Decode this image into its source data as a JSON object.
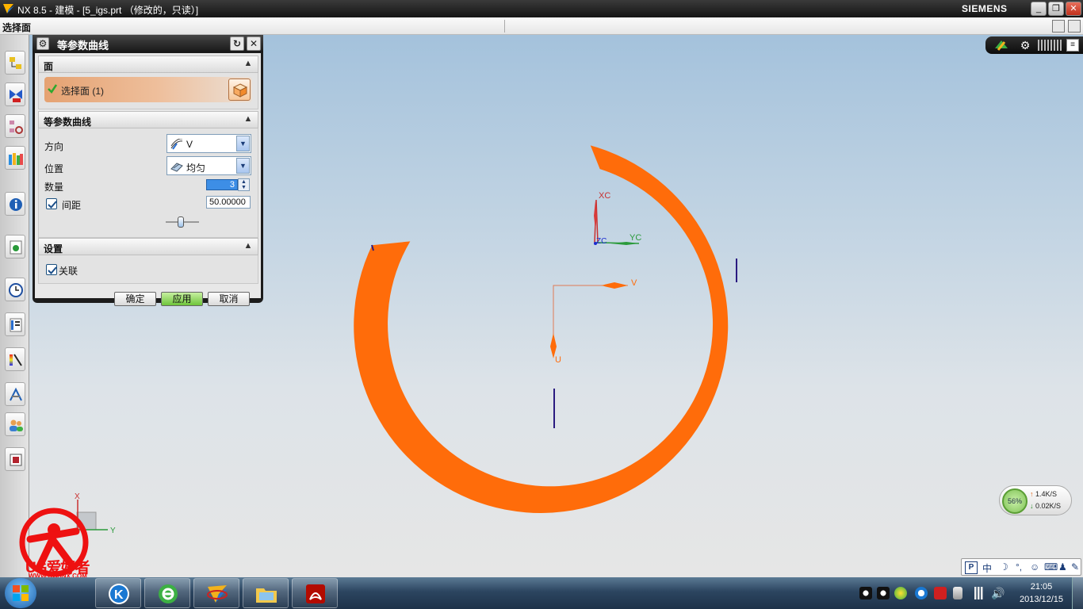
{
  "title_bar": {
    "title": "NX 8.5 - 建模 - [5_igs.prt （修改的，只读）]",
    "brand": "SIEMENS"
  },
  "cue_line": {
    "text": "选择面"
  },
  "dialog": {
    "title": "等参数曲线",
    "face_group": {
      "title": "面",
      "select_label": "选择面 (1)"
    },
    "curve_group": {
      "title": "等参数曲线",
      "direction_label": "方向",
      "direction_value": "V",
      "position_label": "位置",
      "position_value": "均匀",
      "count_label": "数量",
      "count_value": "3",
      "spacing_label": "间距",
      "spacing_checked": true,
      "spacing_value": "50.00000",
      "spacing_slider_level": 0.45
    },
    "settings_group": {
      "title": "设置",
      "associative_label": "关联",
      "associative_checked": true
    },
    "buttons": {
      "ok": "确定",
      "apply": "应用",
      "cancel": "取消"
    }
  },
  "graphics": {
    "labels": {
      "xc": "XC",
      "yc": "YC",
      "zc": "ZC",
      "v": "V",
      "u": "U",
      "x": "X",
      "y": "Y"
    },
    "part_color": "#ff6c0a",
    "background_top": "#a4c2dc",
    "background_bottom": "#e6e6e6"
  },
  "net_monitor": {
    "percent": "56%",
    "up": "1.4K/S",
    "down": "0.02K/S"
  },
  "ime_bar": {
    "mode": "中"
  },
  "watermark": {
    "text": "UG爱好者",
    "url": "WWW.UGSNX.COM"
  },
  "clock": {
    "time": "21:05",
    "date": "2013/12/15"
  },
  "taskbar": {
    "apps": [
      "kugou-icon",
      "ie-browser-icon",
      "nx-icon",
      "explorer-folder-icon",
      "acrobat-icon"
    ]
  },
  "icons": [
    "gear-icon",
    "reset-icon",
    "close-icon",
    "collapse-icon",
    "check-icon",
    "cube-icon",
    "dropdown-arrow-icon"
  ]
}
